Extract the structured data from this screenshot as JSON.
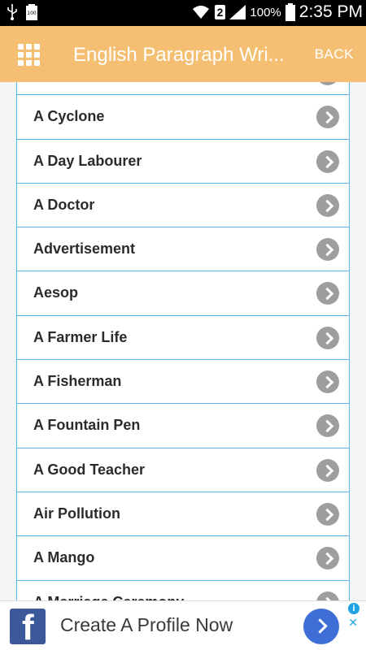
{
  "status_bar": {
    "usb_icon": "usb-icon",
    "battery_small_label": "100",
    "sim_number": "2",
    "battery_percent": "100%",
    "time": "2:35 PM"
  },
  "app_bar": {
    "title": "English Paragraph Wri...",
    "back_label": "BACK",
    "background": "#f5bf73"
  },
  "list": {
    "items": [
      {
        "label": ""
      },
      {
        "label": "A Cyclone"
      },
      {
        "label": "A Day Labourer"
      },
      {
        "label": "A Doctor"
      },
      {
        "label": "Advertisement"
      },
      {
        "label": "Aesop"
      },
      {
        "label": "A Farmer Life"
      },
      {
        "label": "A Fisherman"
      },
      {
        "label": "A Fountain Pen"
      },
      {
        "label": "A Good Teacher"
      },
      {
        "label": "Air Pollution"
      },
      {
        "label": "A Mango"
      },
      {
        "label": "A Marriage Ceremony"
      }
    ]
  },
  "ad": {
    "text": "Create A Profile Now",
    "brand_icon": "facebook-icon"
  }
}
